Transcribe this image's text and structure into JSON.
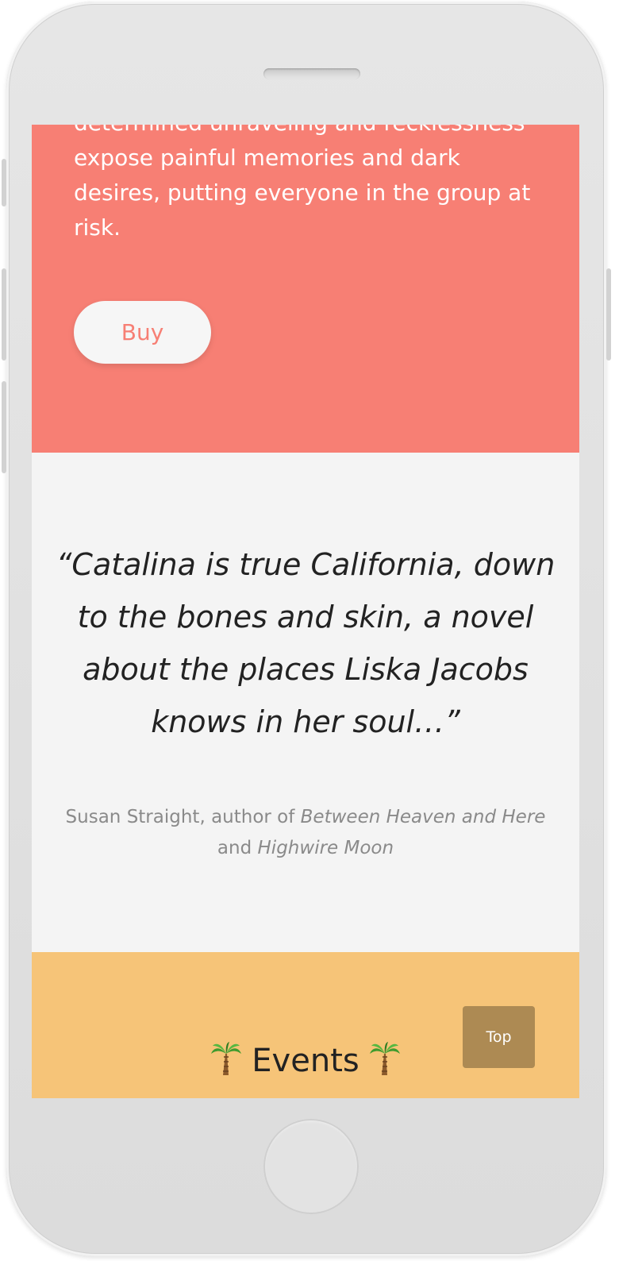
{
  "hero": {
    "text": "determined unraveling and recklessness expose painful memories and dark desires, putting everyone in the group at risk.",
    "buy_label": "Buy",
    "background": "#f77f74"
  },
  "review": {
    "quote": "“Catalina is true California, down to the bones and skin, a novel about the places Liska Jacobs knows in her soul…”",
    "attribution_prefix": "Susan Straight, author of ",
    "book_one": "Between Heaven and Here",
    "connector": " and ",
    "book_two": "Highwire Moon"
  },
  "events": {
    "heading": "Events",
    "icon_left": "palm-tree-icon",
    "icon_right": "palm-tree-icon",
    "background": "#f6c478"
  },
  "top_button": {
    "label": "Top",
    "background": "#ad8a53"
  }
}
